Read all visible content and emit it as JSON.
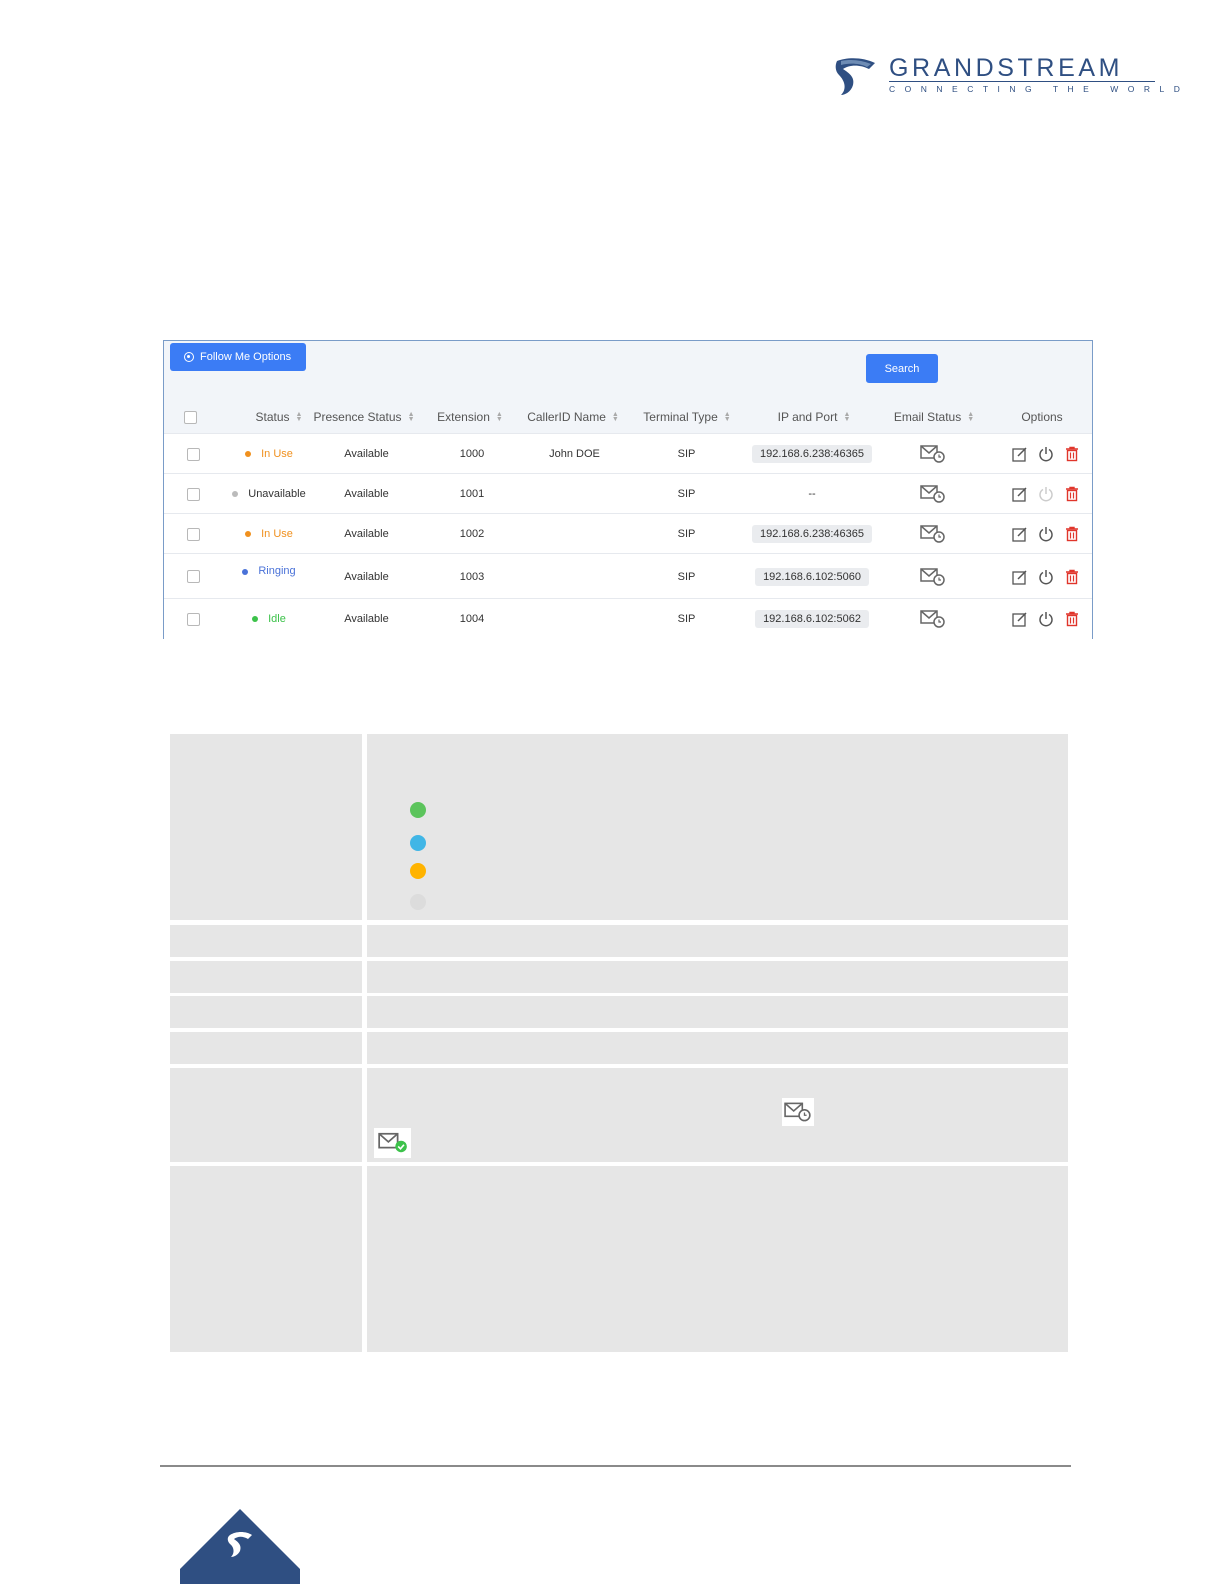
{
  "brand": {
    "name": "GRANDSTREAM",
    "tagline": "CONNECTING THE WORLD",
    "color": "#2f4f82"
  },
  "toolbar": {
    "follow_me_label": "Follow Me Options",
    "search_label": "Search"
  },
  "table": {
    "headers": [
      "Status",
      "Presence Status",
      "Extension",
      "CallerID Name",
      "Terminal Type",
      "IP and Port",
      "Email Status",
      "Options"
    ],
    "rows": [
      {
        "status": "In Use",
        "status_color": "#f0901e",
        "presence": "Available",
        "extension": "1000",
        "callerid": "John DOE",
        "terminal": "SIP",
        "ip": "192.168.6.238:46365"
      },
      {
        "status": "Unavailable",
        "status_color": "#333333",
        "presence": "Available",
        "extension": "1001",
        "callerid": "",
        "terminal": "SIP",
        "ip": "--"
      },
      {
        "status": "In Use",
        "status_color": "#f0901e",
        "presence": "Available",
        "extension": "1002",
        "callerid": "",
        "terminal": "SIP",
        "ip": "192.168.6.238:46365"
      },
      {
        "status": "Ringing",
        "status_color": "#4a72d8",
        "presence": "Available",
        "extension": "1003",
        "callerid": "",
        "terminal": "SIP",
        "ip": "192.168.6.102:5060"
      },
      {
        "status": "Idle",
        "status_color": "#3cc24a",
        "presence": "Available",
        "extension": "1004",
        "callerid": "",
        "terminal": "SIP",
        "ip": "192.168.6.102:5062"
      }
    ]
  },
  "legend_colors": [
    "#5cc45c",
    "#41b6e6",
    "#ffb300",
    "#dcdcdc"
  ],
  "colors": {
    "accent": "#3b7cf5",
    "delete": "#e0352b",
    "row_line": "#e6e9ee"
  }
}
